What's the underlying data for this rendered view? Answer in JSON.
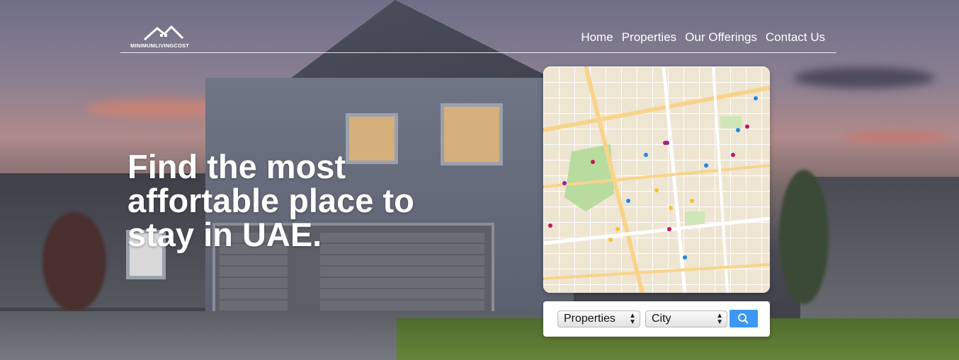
{
  "logo": {
    "name": "MINIMUMLIVINGCOST",
    "icon": "house-roof-logo"
  },
  "nav": {
    "links": [
      "Home",
      "Properties",
      "Our Offerings",
      "Contact Us"
    ]
  },
  "hero": {
    "headline": "Find the most affortable place to stay in UAE."
  },
  "map": {
    "icon": "city-map"
  },
  "search": {
    "type_select": {
      "selected": "Properties"
    },
    "city_select": {
      "selected": "City"
    },
    "button_icon": "magnifier-icon"
  },
  "colors": {
    "nav_text": "#ffffff",
    "search_button": "#3d97f3",
    "headline": "#ffffff"
  }
}
